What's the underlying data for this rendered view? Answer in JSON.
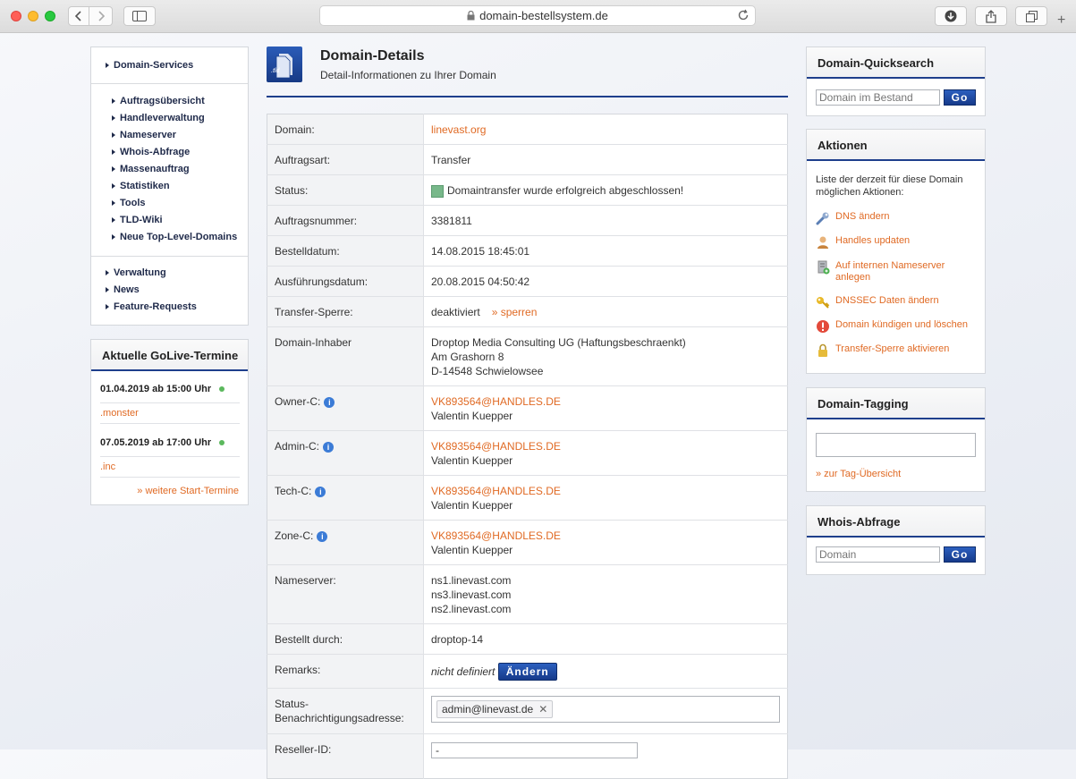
{
  "browser": {
    "url": "domain-bestellsystem.de"
  },
  "nav": {
    "section1": "Domain-Services",
    "items1": [
      "Auftragsübersicht",
      "Handleverwaltung",
      "Nameserver",
      "Whois-Abfrage",
      "Massenauftrag",
      "Statistiken",
      "Tools",
      "TLD-Wiki",
      "Neue Top-Level-Domains"
    ],
    "items2": [
      "Verwaltung",
      "News",
      "Feature-Requests"
    ]
  },
  "golive": {
    "title": "Aktuelle GoLive-Termine",
    "entries": [
      {
        "date": "01.04.2019 ab 15:00 Uhr",
        "tld": ".monster"
      },
      {
        "date": "07.05.2019 ab 17:00 Uhr",
        "tld": ".inc"
      }
    ],
    "more": "» weitere Start-Termine"
  },
  "header": {
    "title": "Domain-Details",
    "subtitle": "Detail-Informationen zu Ihrer Domain",
    "icon_label": ".tld"
  },
  "details": {
    "domain_label": "Domain:",
    "domain_value": "linevast.org",
    "order_type_label": "Auftragsart:",
    "order_type_value": "Transfer",
    "status_label": "Status:",
    "status_value": "Domaintransfer wurde erfolgreich abgeschlossen!",
    "order_no_label": "Auftragsnummer:",
    "order_no_value": "3381811",
    "ordered_label": "Bestelldatum:",
    "ordered_value": "14.08.2015 18:45:01",
    "executed_label": "Ausführungsdatum:",
    "executed_value": "20.08.2015 04:50:42",
    "lock_label": "Transfer-Sperre:",
    "lock_value": "deaktiviert",
    "lock_link": "» sperren",
    "owner_label": "Domain-Inhaber",
    "owner_lines": [
      "Droptop Media Consulting UG (Haftungsbeschraenkt)",
      "Am Grashorn 8",
      "D-14548 Schwielowsee"
    ],
    "handles": [
      {
        "label": "Owner-C:",
        "handle": "VK893564@HANDLES.DE",
        "name": "Valentin Kuepper"
      },
      {
        "label": "Admin-C:",
        "handle": "VK893564@HANDLES.DE",
        "name": "Valentin Kuepper"
      },
      {
        "label": "Tech-C:",
        "handle": "VK893564@HANDLES.DE",
        "name": "Valentin Kuepper"
      },
      {
        "label": "Zone-C:",
        "handle": "VK893564@HANDLES.DE",
        "name": "Valentin Kuepper"
      }
    ],
    "ns_label": "Nameserver:",
    "ns_lines": [
      "ns1.linevast.com",
      "ns3.linevast.com",
      "ns2.linevast.com"
    ],
    "ordered_by_label": "Bestellt durch:",
    "ordered_by_value": "droptop-14",
    "remarks_label": "Remarks:",
    "remarks_value": "nicht definiert",
    "remarks_button": "Ändern",
    "notify_label_1": "Status-",
    "notify_label_2": "Benachrichtigungsadresse:",
    "notify_tag": "admin@linevast.de",
    "reseller_label": "Reseller-ID:",
    "reseller_value": "-"
  },
  "quicksearch": {
    "title": "Domain-Quicksearch",
    "placeholder": "Domain im Bestand",
    "go": "Go"
  },
  "actions": {
    "title": "Aktionen",
    "intro": "Liste der derzeit für diese Domain möglichen Aktionen:",
    "items": [
      {
        "label": "DNS ändern",
        "icon": "wrench-icon"
      },
      {
        "label": "Handles updaten",
        "icon": "user-icon"
      },
      {
        "label": "Auf internen Nameserver anlegen",
        "icon": "server-icon"
      },
      {
        "label": "DNSSEC Daten ändern",
        "icon": "key-icon"
      },
      {
        "label": "Domain kündigen und löschen",
        "icon": "alert-icon"
      },
      {
        "label": "Transfer-Sperre aktivieren",
        "icon": "lock-icon"
      }
    ]
  },
  "tagging": {
    "title": "Domain-Tagging",
    "link": "» zur Tag-Übersicht"
  },
  "whois": {
    "title": "Whois-Abfrage",
    "placeholder": "Domain",
    "go": "Go"
  }
}
